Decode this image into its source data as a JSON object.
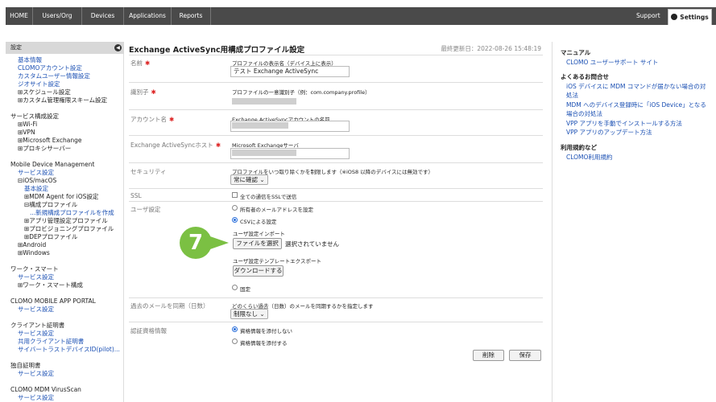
{
  "nav": {
    "items": [
      "HOME",
      "Users/Org",
      "Devices",
      "Applications",
      "Reports"
    ],
    "support": "Support",
    "settings": "Settings"
  },
  "sidebar": {
    "header": "設定",
    "lines": [
      {
        "text": "基本情報",
        "style": "link",
        "indent": 1
      },
      {
        "text": "CLOMOアカウント設定",
        "style": "link",
        "indent": 1
      },
      {
        "text": "カスタムユーザー情報設定",
        "style": "link",
        "indent": 1
      },
      {
        "text": "ジオサイト設定",
        "style": "link",
        "indent": 1
      },
      {
        "text": "⊞スケジュール設定",
        "style": "plain",
        "indent": 1
      },
      {
        "text": "⊞カスタム管理権限スキーム設定",
        "style": "plain",
        "indent": 1
      },
      {
        "text": "",
        "style": "gap",
        "indent": 0
      },
      {
        "text": "サービス構成設定",
        "style": "head",
        "indent": 0
      },
      {
        "text": "⊞Wi-Fi",
        "style": "plain",
        "indent": 1
      },
      {
        "text": "⊞VPN",
        "style": "plain",
        "indent": 1
      },
      {
        "text": "⊞Microsoft Exchange",
        "style": "plain",
        "indent": 1
      },
      {
        "text": "⊞プロキシサーバー",
        "style": "plain",
        "indent": 1
      },
      {
        "text": "",
        "style": "gap",
        "indent": 0
      },
      {
        "text": "Mobile Device Management",
        "style": "head",
        "indent": 0
      },
      {
        "text": "サービス設定",
        "style": "link",
        "indent": 1
      },
      {
        "text": "⊟iOS/macOS",
        "style": "plain",
        "indent": 1
      },
      {
        "text": "基本設定",
        "style": "link",
        "indent": 2
      },
      {
        "text": "⊞MDM Agent for iOS設定",
        "style": "plain",
        "indent": 2
      },
      {
        "text": "⊟構成プロファイル",
        "style": "plain",
        "indent": 2
      },
      {
        "text": "...新規構成プロファイルを作成",
        "style": "link",
        "indent": 3
      },
      {
        "text": "⊞アプリ管理設定プロファイル",
        "style": "plain",
        "indent": 2
      },
      {
        "text": "⊞プロビジョニングプロファイル",
        "style": "plain",
        "indent": 2
      },
      {
        "text": "⊞DEPプロファイル",
        "style": "plain",
        "indent": 2
      },
      {
        "text": "⊞Android",
        "style": "plain",
        "indent": 1
      },
      {
        "text": "⊞Windows",
        "style": "plain",
        "indent": 1
      },
      {
        "text": "",
        "style": "gap",
        "indent": 0
      },
      {
        "text": "ワーク・スマート",
        "style": "head",
        "indent": 0
      },
      {
        "text": "サービス設定",
        "style": "link",
        "indent": 1
      },
      {
        "text": "⊞ワーク・スマート構成",
        "style": "plain",
        "indent": 1
      },
      {
        "text": "",
        "style": "gap",
        "indent": 0
      },
      {
        "text": "CLOMO MOBILE APP PORTAL",
        "style": "head",
        "indent": 0
      },
      {
        "text": "サービス設定",
        "style": "link",
        "indent": 1
      },
      {
        "text": "",
        "style": "gap",
        "indent": 0
      },
      {
        "text": "クライアント証明書",
        "style": "head",
        "indent": 0
      },
      {
        "text": "サービス設定",
        "style": "link",
        "indent": 1
      },
      {
        "text": "共用クライアント証明書",
        "style": "link",
        "indent": 1
      },
      {
        "text": "サイバートラストデバイスID(pilot)...",
        "style": "link",
        "indent": 1
      },
      {
        "text": "",
        "style": "gap",
        "indent": 0
      },
      {
        "text": "独自証明書",
        "style": "head",
        "indent": 0
      },
      {
        "text": "サービス設定",
        "style": "link",
        "indent": 1
      },
      {
        "text": "",
        "style": "gap",
        "indent": 0
      },
      {
        "text": "CLOMO MDM VirusScan",
        "style": "head",
        "indent": 0
      },
      {
        "text": "サービス設定",
        "style": "link",
        "indent": 1
      }
    ]
  },
  "main": {
    "title": "Exchange ActiveSync用構成プロファイル設定",
    "updated": "最終更新日：2022-08-26 15:48:19",
    "name": {
      "label": "名前",
      "desc": "プロファイルの表示名（デバイス上に表示）",
      "value": "テスト Exchange ActiveSync"
    },
    "identifier": {
      "label": "識別子",
      "desc": "プロファイルの一意識別子（例：com.company.profile）"
    },
    "account": {
      "label": "アカウント名",
      "desc": "Exchange ActiveSyncアカウントの名前"
    },
    "host": {
      "label": "Exchange ActiveSyncホスト",
      "desc": "Microsoft Exchangeサーバ"
    },
    "security": {
      "label": "セキュリティ",
      "desc": "プロファイルをいつ取り除くかを制限します（※iOS8 以降のデバイスには無効です）",
      "select": "常に確認"
    },
    "ssl": {
      "label": "SSL",
      "checkbox": "全ての通信をSSLで送信"
    },
    "user": {
      "label": "ユーザ設定",
      "opt1": "所有者のメールアドレスを設定",
      "opt2": "CSVによる設定",
      "import_label": "ユーザ設定インポート",
      "file_button": "ファイルを選択",
      "file_status": "選択されていません",
      "export_label": "ユーザ設定テンプレートエクスポート",
      "download_button": "ダウンロードする",
      "opt3": "固定"
    },
    "past_mail": {
      "label": "過去のメールを同期（日数）",
      "desc": "どのくらい過去（日数）のメールを同期するかを指定します",
      "select": "制限なし"
    },
    "auth": {
      "label": "認証資格情報",
      "opt1": "資格情報を添付しない",
      "opt2": "資格情報を添付する"
    },
    "delete_button": "削除",
    "save_button": "保存",
    "step_number": "7"
  },
  "right": {
    "manual_head": "マニュアル",
    "manual_link": "CLOMO ユーザーサポート サイト",
    "faq_head": "よくあるお問合せ",
    "faq_links": [
      "iOS デバイスに MDM コマンドが届かない場合の対処法",
      "MDM へのデバイス登録時に「iOS Device」となる場合の対処法",
      "VPP アプリを手動でインストールする方法",
      "VPP アプリのアップデート方法"
    ],
    "terms_head": "利用規約など",
    "terms_link": "CLOMO利用規約"
  }
}
